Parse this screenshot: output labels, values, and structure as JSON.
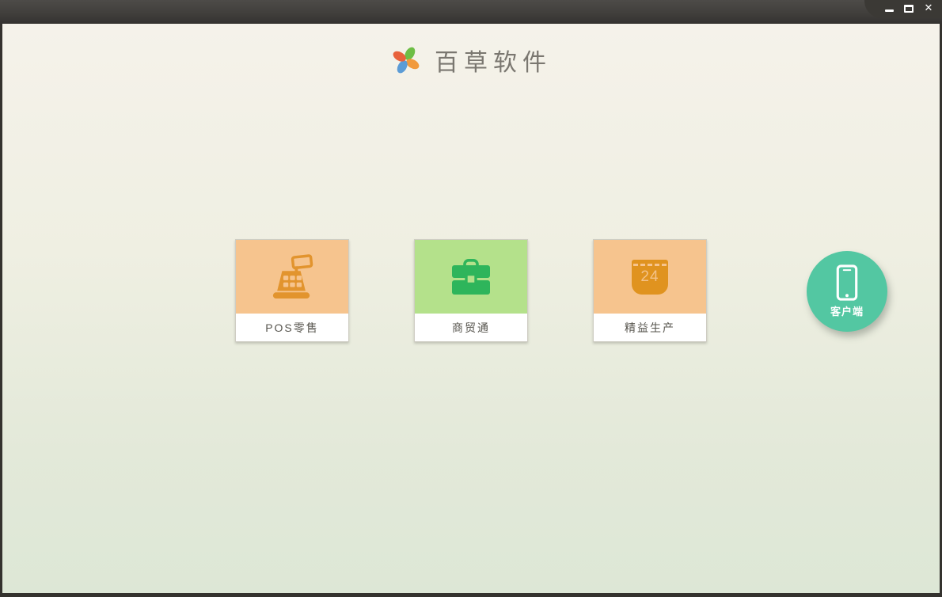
{
  "window": {
    "controls": [
      {
        "name": "minimize-icon"
      },
      {
        "name": "maximize-icon"
      },
      {
        "name": "close-icon",
        "glyph": "✕"
      }
    ]
  },
  "header": {
    "logo": "pinwheel-logo",
    "title": "百草软件"
  },
  "products": [
    {
      "label": "POS零售",
      "icon": "cash-register-icon",
      "bg_color": "#f6c48e",
      "icon_color": "#e2942e"
    },
    {
      "label": "商贸通",
      "icon": "briefcase-icon",
      "bg_color": "#b4e18b",
      "icon_color": "#2eb55b"
    },
    {
      "label": "精益生产",
      "icon": "calendar-24-icon",
      "bg_color": "#f6c48e",
      "icon_color": "#e0931f",
      "badge": "24"
    }
  ],
  "client_button": {
    "label": "客户端",
    "icon": "smartphone-icon",
    "bg_color": "#53c7a2"
  },
  "colors": {
    "titlebar": "#413f3c",
    "frame": "#34322e",
    "content_top": "#f5f2ea",
    "content_bottom": "#dde7d6"
  }
}
